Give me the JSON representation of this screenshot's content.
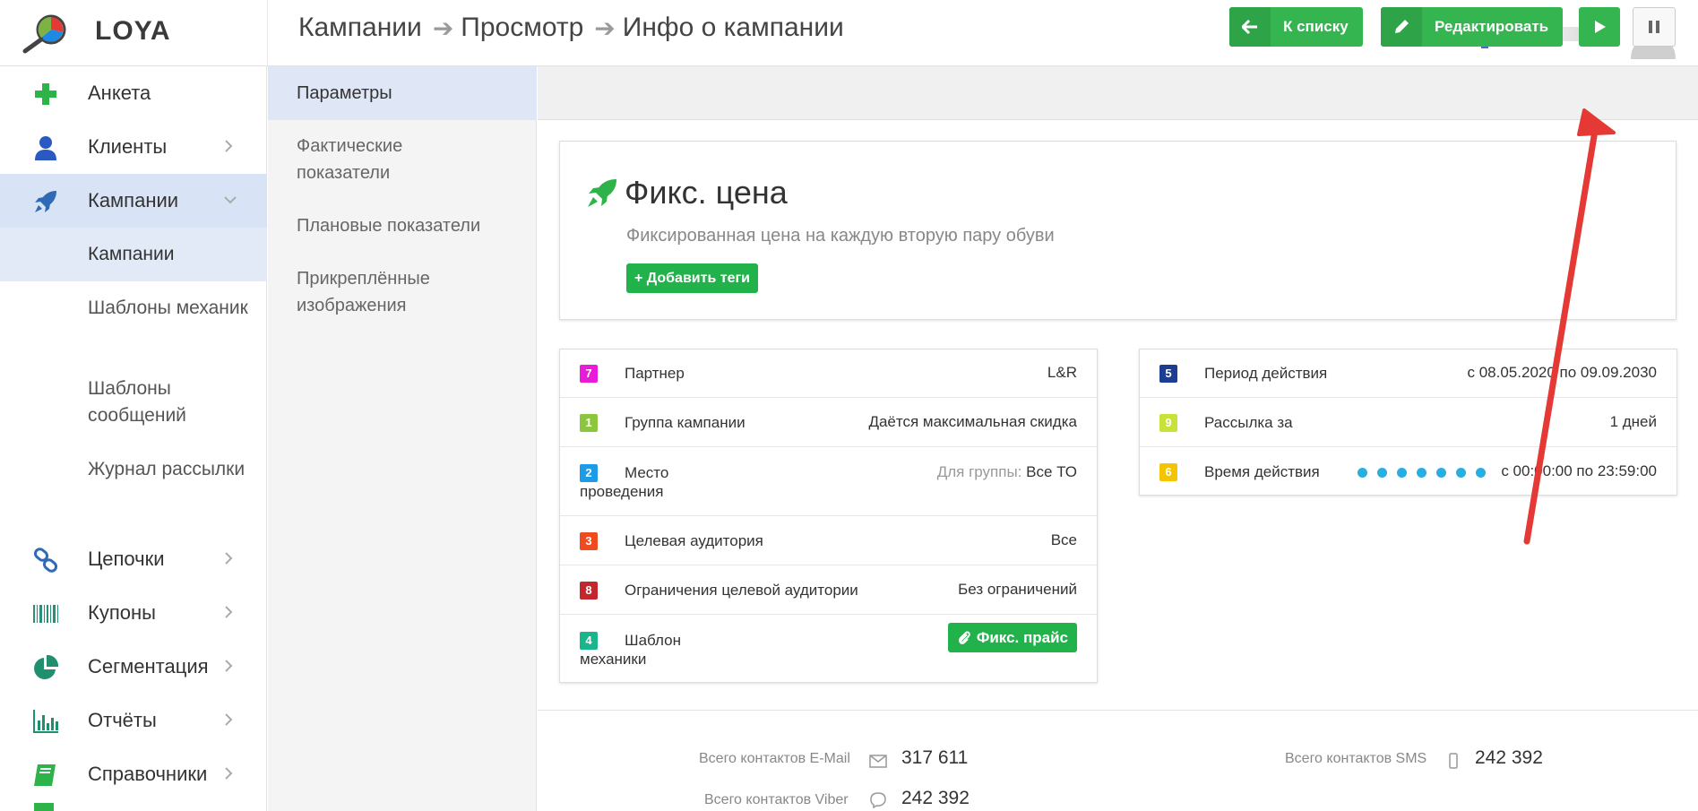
{
  "app": {
    "brand": "LOYA"
  },
  "breadcrumb": [
    "Кампании",
    "Просмотр",
    "Инфо о кампании"
  ],
  "sidebar": {
    "items": [
      {
        "label": "Анкета",
        "icon": "plus-icon"
      },
      {
        "label": "Клиенты",
        "icon": "user-icon"
      },
      {
        "label": "Кампании",
        "icon": "rocket-icon"
      },
      {
        "label": "Цепочки",
        "icon": "link-icon"
      },
      {
        "label": "Купоны",
        "icon": "barcode-icon"
      },
      {
        "label": "Сегментация",
        "icon": "pie-chart-icon"
      },
      {
        "label": "Отчёты",
        "icon": "bar-chart-icon"
      },
      {
        "label": "Справочники",
        "icon": "book-icon"
      }
    ],
    "subitems": [
      {
        "label": "Кампании"
      },
      {
        "label": "Шаблоны механик"
      },
      {
        "label": "Шаблоны сообщений"
      },
      {
        "label": "Журнал рассылки"
      }
    ]
  },
  "submenu": [
    {
      "label": "Параметры"
    },
    {
      "label": "Фактические показатели"
    },
    {
      "label": "Плановые показатели"
    },
    {
      "label": "Прикреплённые изображения"
    }
  ],
  "toolbar": {
    "back_label": "К списку",
    "edit_label": "Редактировать"
  },
  "campaign": {
    "title": "Фикс. цена",
    "description": "Фиксированная цена на каждую вторую пару обуви",
    "add_tags_label": "+ Добавить теги"
  },
  "params_left": [
    {
      "badge": "7",
      "badge_color": "#e91bd9",
      "label": "Партнер",
      "value": "L&R"
    },
    {
      "badge": "1",
      "badge_color": "#8cc63f",
      "label": "Группа кампании",
      "value": "Даётся максимальная скидка"
    },
    {
      "badge": "2",
      "badge_color": "#1e9be6",
      "label": "Место",
      "label_cont": "проведения",
      "value_prefix": "Для группы:",
      "value": "Все ТО"
    },
    {
      "badge": "3",
      "badge_color": "#f04a1f",
      "label": "Целевая аудитория",
      "value": "Все"
    },
    {
      "badge": "8",
      "badge_color": "#c1272d",
      "label": "Ограничения целевой аудитории",
      "value": "Без ограничений"
    },
    {
      "badge": "4",
      "badge_color": "#19b58c",
      "label": "Шаблон",
      "label_cont": "механики",
      "value": "Фикс. прайс"
    }
  ],
  "params_right": [
    {
      "badge": "5",
      "badge_color": "#1b3d94",
      "label": "Период действия",
      "value": "с 08.05.2020 по 09.09.2030"
    },
    {
      "badge": "9",
      "badge_color": "#c8e23a",
      "label": "Рассылка за",
      "value": "1 дней"
    },
    {
      "badge": "6",
      "badge_color": "#f5c400",
      "label": "Время действия",
      "value": "с 00:00:00 по 23:59:00"
    }
  ],
  "stats": {
    "email_label": "Всего контактов E-Mail",
    "email_value": "317 611",
    "sms_label": "Всего контактов SMS",
    "sms_value": "242 392",
    "viber_label": "Всего контактов Viber",
    "viber_value": "242 392"
  },
  "colors": {
    "accent_green": "#34b550",
    "annotation_red": "#e53935",
    "active_nav": "#d9e3f6"
  }
}
